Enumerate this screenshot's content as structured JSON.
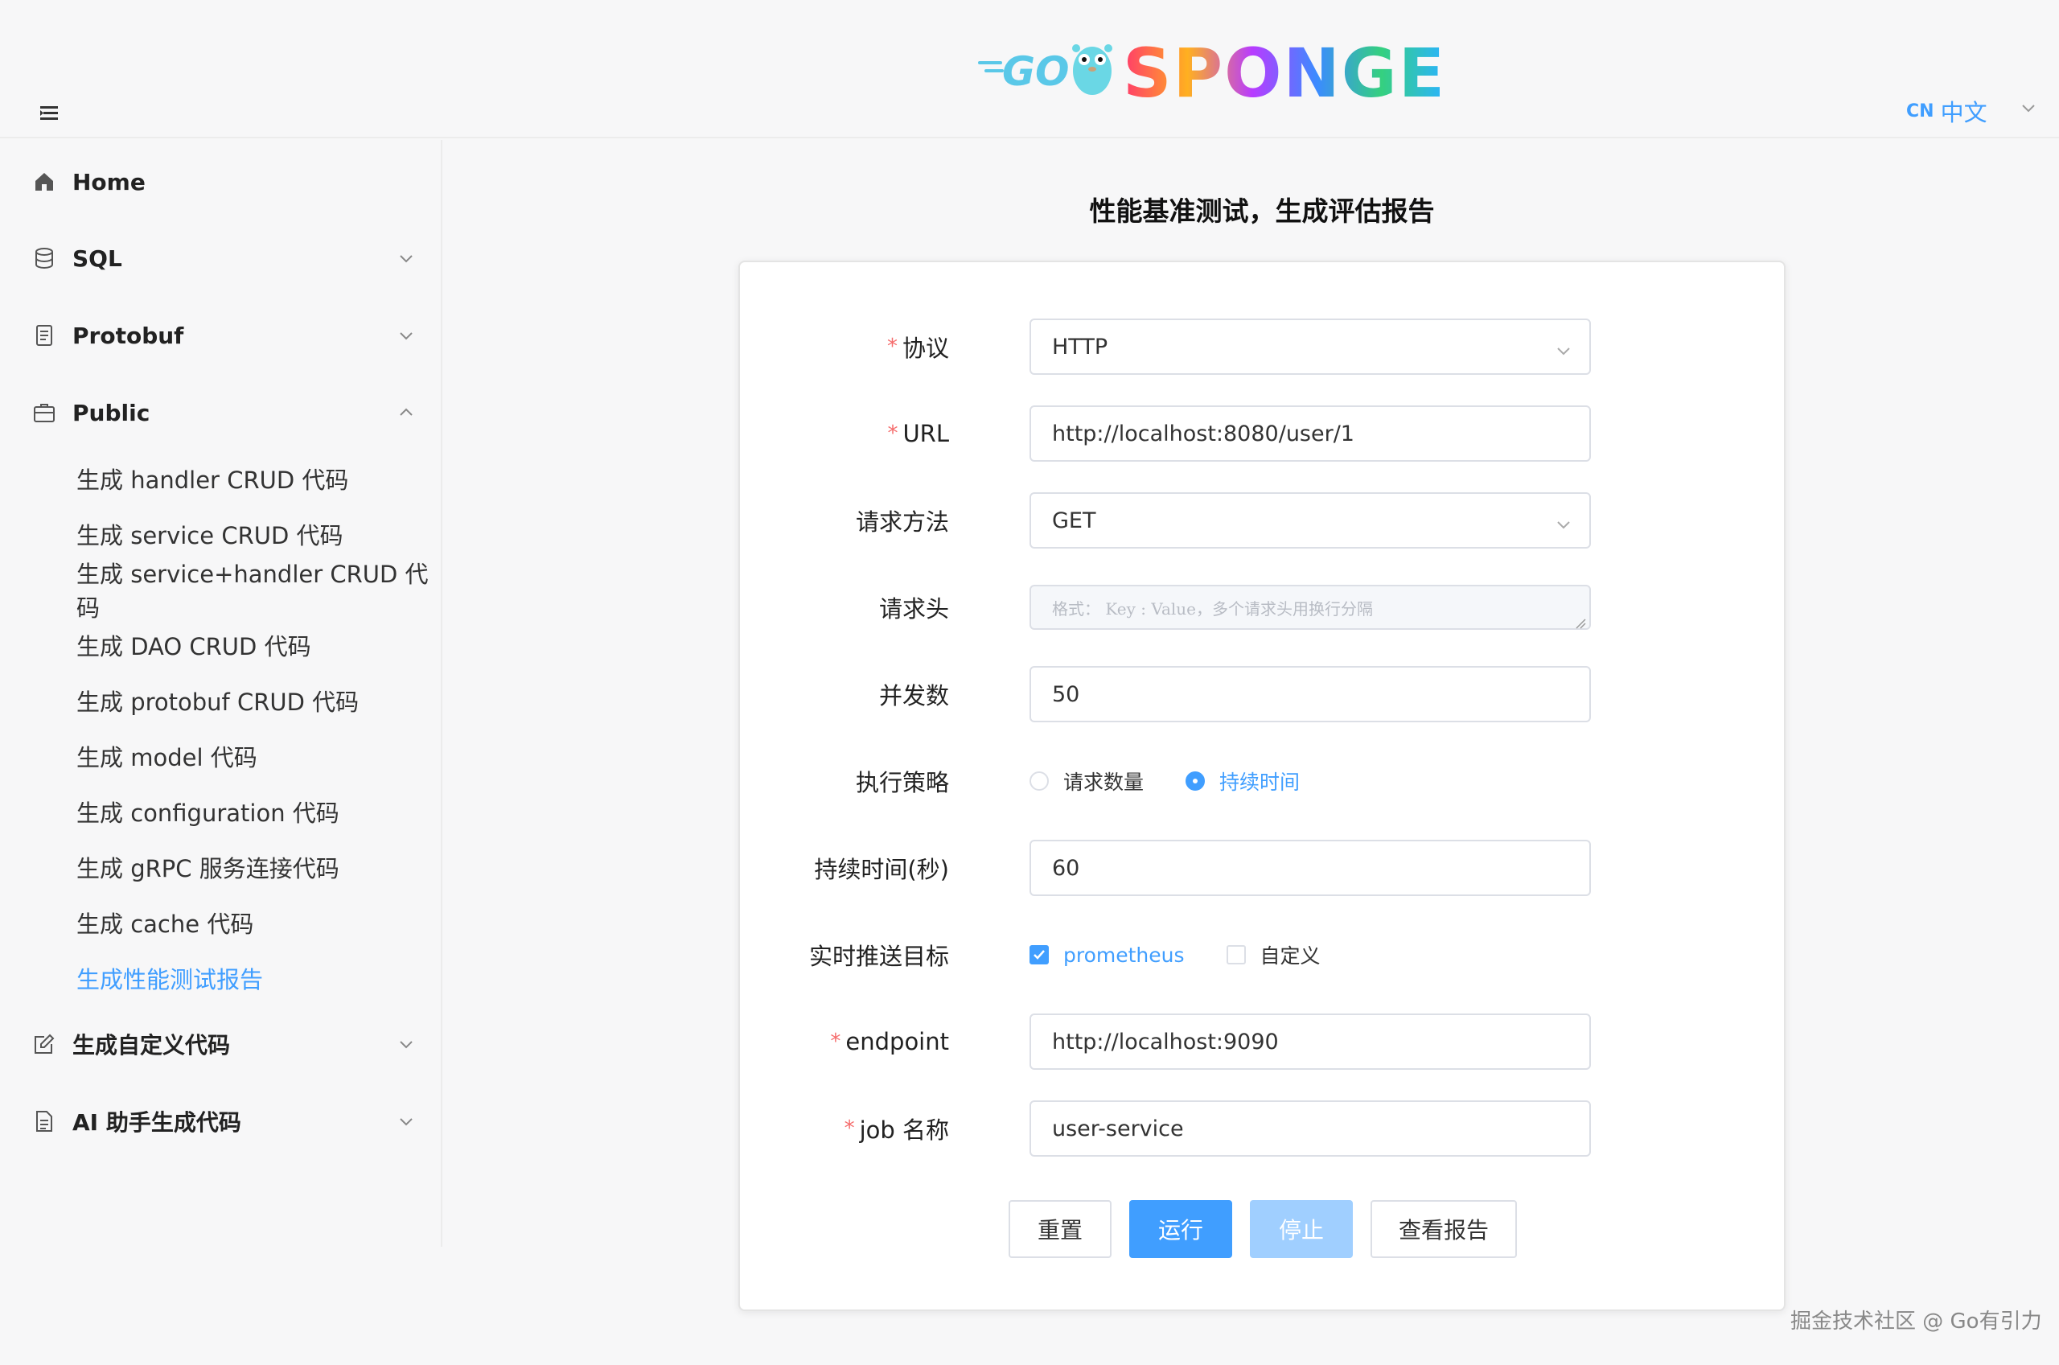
{
  "header": {
    "logo_alt": "GO SPONGE",
    "lang_code": "CN",
    "lang_name": "中文"
  },
  "sidebar": {
    "groups": {
      "home": "Home",
      "sql": "SQL",
      "protobuf": "Protobuf",
      "public": "Public",
      "custom": "生成自定义代码",
      "ai": "AI 助手生成代码"
    },
    "public_items": [
      "生成 handler CRUD 代码",
      "生成 service CRUD 代码",
      "生成 service+handler CRUD 代码",
      "生成 DAO CRUD 代码",
      "生成 protobuf CRUD 代码",
      "生成 model 代码",
      "生成 configuration 代码",
      "生成 gRPC 服务连接代码",
      "生成 cache 代码",
      "生成性能测试报告"
    ],
    "active_index": 9
  },
  "main": {
    "title": "性能基准测试，生成评估报告",
    "form": {
      "protocol": {
        "label": "协议",
        "value": "HTTP"
      },
      "url": {
        "label": "URL",
        "value": "http://localhost:8080/user/1"
      },
      "method": {
        "label": "请求方法",
        "value": "GET"
      },
      "headers": {
        "label": "请求头",
        "placeholder": "格式： Key : Value，多个请求头用换行分隔"
      },
      "concurrency": {
        "label": "并发数",
        "value": "50"
      },
      "strategy": {
        "label": "执行策略",
        "options": [
          "请求数量",
          "持续时间"
        ],
        "selected": "持续时间"
      },
      "duration": {
        "label": "持续时间(秒)",
        "value": "60"
      },
      "push_target": {
        "label": "实时推送目标",
        "options": [
          "prometheus",
          "自定义"
        ],
        "checked": [
          "prometheus"
        ]
      },
      "endpoint": {
        "label": "endpoint",
        "value": "http://localhost:9090"
      },
      "job_name": {
        "label": "job 名称",
        "value": "user-service"
      }
    },
    "buttons": {
      "reset": "重置",
      "run": "运行",
      "stop": "停止",
      "view_report": "查看报告"
    }
  },
  "watermark": "掘金技术社区 @ Go有引力",
  "colors": {
    "accent": "#409eff",
    "required": "#f56c6c",
    "disabled": "#a0cfff",
    "background": "#f7f7f8"
  }
}
